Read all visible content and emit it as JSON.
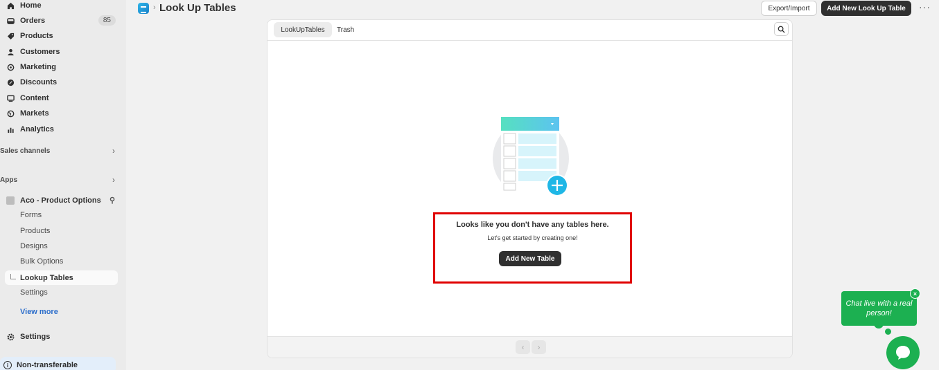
{
  "sidebar": {
    "nav": [
      {
        "label": "Home",
        "icon": "home-icon"
      },
      {
        "label": "Orders",
        "icon": "orders-icon",
        "badge": "85"
      },
      {
        "label": "Products",
        "icon": "tag-icon"
      },
      {
        "label": "Customers",
        "icon": "person-icon"
      },
      {
        "label": "Marketing",
        "icon": "target-icon"
      },
      {
        "label": "Discounts",
        "icon": "discount-icon"
      },
      {
        "label": "Content",
        "icon": "content-icon"
      },
      {
        "label": "Markets",
        "icon": "globe-icon"
      },
      {
        "label": "Analytics",
        "icon": "bar-chart-icon"
      }
    ],
    "sales_channels": "Sales channels",
    "apps": "Apps",
    "app_name": "Aco - Product Options",
    "app_sub_items": [
      "Forms",
      "Products",
      "Designs",
      "Bulk Options"
    ],
    "active_sub_item": "Lookup Tables",
    "after_active": "Settings",
    "view_more": "View more",
    "settings": "Settings",
    "non_transferable": "Non-transferable"
  },
  "header": {
    "breadcrumb_sep": "›",
    "title": "Look Up Tables",
    "export_label": "Export/Import",
    "add_label": "Add New Look Up Table",
    "more": "···"
  },
  "tabs": [
    "LookUpTables",
    "Trash"
  ],
  "empty_state": {
    "title": "Looks like you don't have any tables here.",
    "subtitle": "Let's get started by creating one!",
    "button": "Add New Table"
  },
  "chat": {
    "bubble_text": "Chat live with a real person!",
    "close": "×"
  },
  "colors": {
    "primary_button": "#303030",
    "chat_green": "#1cb051",
    "highlight_red": "#e00000",
    "link_blue": "#2c6ecb"
  }
}
